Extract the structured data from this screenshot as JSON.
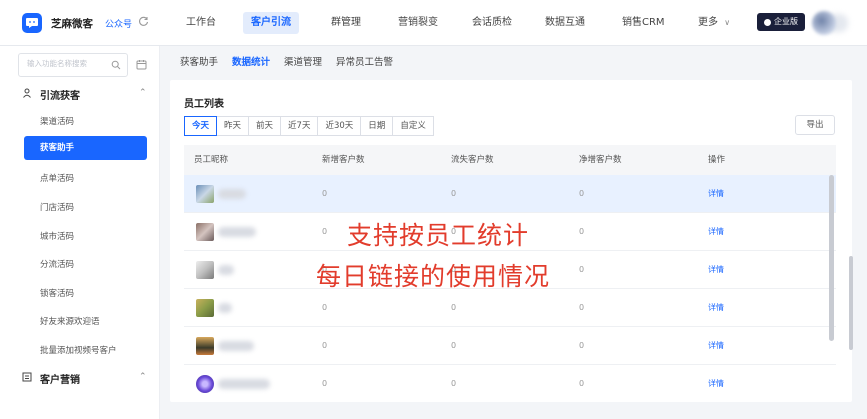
{
  "brand": {
    "name": "芝麻微客",
    "subtitle": "公众号"
  },
  "nav": {
    "items": [
      "工作台",
      "客户引流",
      "群管理",
      "营销裂变",
      "会话质检",
      "数据互通",
      "销售CRM",
      "更多"
    ],
    "active": "客户引流",
    "more_chevron": "∨"
  },
  "badge": {
    "label": "企业版"
  },
  "sidebar": {
    "search_placeholder": "输入功能名称搜索",
    "groups": [
      {
        "label": "引流获客",
        "icon": "user-icon",
        "items": [
          "渠道活码",
          "获客助手",
          "点单活码",
          "门店活码",
          "城市活码",
          "分流活码",
          "锁客活码",
          "好友来源欢迎语",
          "批量添加视频号客户"
        ]
      },
      {
        "label": "客户营销",
        "icon": "list-icon",
        "items": []
      }
    ],
    "active_item": "获客助手"
  },
  "subtabs": {
    "items": [
      "获客助手",
      "数据统计",
      "渠道管理",
      "异常员工告警"
    ],
    "active": "数据统计"
  },
  "card": {
    "title": "员工列表",
    "periods": [
      "今天",
      "昨天",
      "前天",
      "近7天",
      "近30天",
      "日期",
      "自定义"
    ],
    "active_period": "今天",
    "export_label": "导出"
  },
  "table": {
    "columns": [
      "员工昵称",
      "新增客户数",
      "流失客户数",
      "净增客户数",
      "操作"
    ],
    "rows": [
      {
        "new": "0",
        "lost": "0",
        "net": "0",
        "action": "详情"
      },
      {
        "new": "0",
        "lost": "0",
        "net": "0",
        "action": "详情"
      },
      {
        "new": "0",
        "lost": "0",
        "net": "0",
        "action": "详情"
      },
      {
        "new": "0",
        "lost": "0",
        "net": "0",
        "action": "详情"
      },
      {
        "new": "0",
        "lost": "0",
        "net": "0",
        "action": "详情"
      },
      {
        "new": "0",
        "lost": "0",
        "net": "0",
        "action": "详情"
      }
    ]
  },
  "overlay": {
    "line1": "支持按员工统计",
    "line2": "每日链接的使用情况"
  },
  "colors": {
    "accent": "#1966ff",
    "overlay_text": "#e23c2c",
    "highlight_row": "#e8f1ff"
  }
}
